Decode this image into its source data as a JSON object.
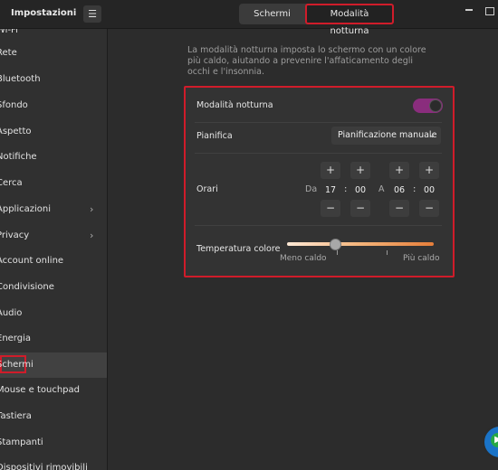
{
  "header": {
    "sidebar_title": "Impostazioni",
    "menu_icon": "☰",
    "tabs": [
      {
        "label": "Schermi"
      },
      {
        "label": "Modalità notturna"
      }
    ]
  },
  "sidebar": {
    "items": [
      {
        "label": "Wi-Fi"
      },
      {
        "label": "Rete"
      },
      {
        "label": "Bluetooth"
      },
      {
        "label": "Sfondo"
      },
      {
        "label": "Aspetto"
      },
      {
        "label": "Notifiche"
      },
      {
        "label": "Cerca"
      },
      {
        "label": "Applicazioni",
        "chevron": "›"
      },
      {
        "label": "Privacy",
        "chevron": "›"
      },
      {
        "label": "Account online"
      },
      {
        "label": "Condivisione"
      },
      {
        "label": "Audio"
      },
      {
        "label": "Energia"
      },
      {
        "label": "Schermi"
      },
      {
        "label": "Mouse e touchpad"
      },
      {
        "label": "Tastiera"
      },
      {
        "label": "Stampanti"
      },
      {
        "label": "Dispositivi rimovibili"
      }
    ]
  },
  "main": {
    "description": "La modalità notturna imposta lo schermo con un colore più caldo, aiutando a prevenire l'affaticamento degli occhi e l'insonnia.",
    "night_mode": {
      "label": "Modalità notturna",
      "enabled": true
    },
    "schedule": {
      "label": "Pianifica",
      "value": "Pianificazione manuale"
    },
    "times": {
      "label": "Orari",
      "from_label": "Da",
      "to_label": "A",
      "from_hour": "17",
      "from_minute": "00",
      "to_hour": "06",
      "to_minute": "00",
      "separator": ":",
      "plus": "+",
      "minus": "−"
    },
    "temperature": {
      "label": "Temperatura colore",
      "min_label": "Meno caldo",
      "max_label": "Più caldo",
      "level": 0.33,
      "colors": [
        "#ffe9d6",
        "#f4b47a",
        "#e67e3a"
      ]
    }
  },
  "colors": {
    "highlight": "#d01c2a",
    "toggle_on": "#8a2d7d"
  }
}
